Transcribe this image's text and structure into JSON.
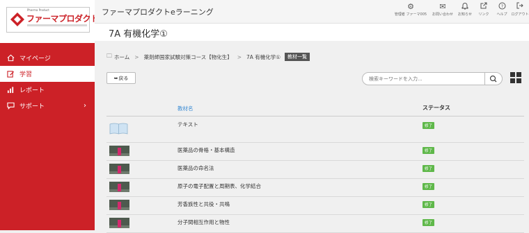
{
  "brand": {
    "logo_top": "Pharma Product",
    "logo_main": "ファーマプロダクト"
  },
  "app_title": "ファーマプロダクトeラーニング",
  "header_icons": [
    {
      "icon": "gear-icon",
      "label": "管理者 ファーマ005"
    },
    {
      "icon": "mail-icon",
      "label": "お問い合わせ"
    },
    {
      "icon": "bell-icon",
      "label": "お知らせ"
    },
    {
      "icon": "external-link-icon",
      "label": "リンク"
    },
    {
      "icon": "help-icon",
      "label": "ヘルプ"
    },
    {
      "icon": "logout-icon",
      "label": "ログアウト"
    }
  ],
  "sidebar": {
    "items": [
      {
        "label": "マイページ",
        "icon": "home-icon",
        "active": false
      },
      {
        "label": "学習",
        "icon": "edit-icon",
        "active": true
      },
      {
        "label": "レポート",
        "icon": "bar-chart-icon",
        "active": false
      },
      {
        "label": "サポート",
        "icon": "chat-icon",
        "active": false
      }
    ]
  },
  "page_title": "7A 有機化学①",
  "breadcrumb": {
    "home": "ホーム",
    "course": "薬剤師国家試験対策コース【物化生】",
    "current": "7A 有機化学①",
    "badge": "教材一覧"
  },
  "back_label": "戻る",
  "search": {
    "placeholder": "検索キーワードを入力..."
  },
  "table": {
    "headers": {
      "name": "教材名",
      "status": "ステータス"
    },
    "rows": [
      {
        "name": "テキスト",
        "status": "修了",
        "thumb": "book"
      },
      {
        "name": "医薬品の骨格・基本構造",
        "status": "修了",
        "thumb": "video"
      },
      {
        "name": "医薬品の命名法",
        "status": "修了",
        "thumb": "video"
      },
      {
        "name": "原子の電子配置と周期表、化学結合",
        "status": "修了",
        "thumb": "video"
      },
      {
        "name": "芳香族性と共役・共鳴",
        "status": "修了",
        "thumb": "video"
      },
      {
        "name": "分子間相互作用と物性",
        "status": "修了",
        "thumb": "video"
      }
    ]
  },
  "colors": {
    "brand_red": "#cc2127",
    "status_green": "#5fb84a",
    "link_blue": "#3a8bd4"
  }
}
